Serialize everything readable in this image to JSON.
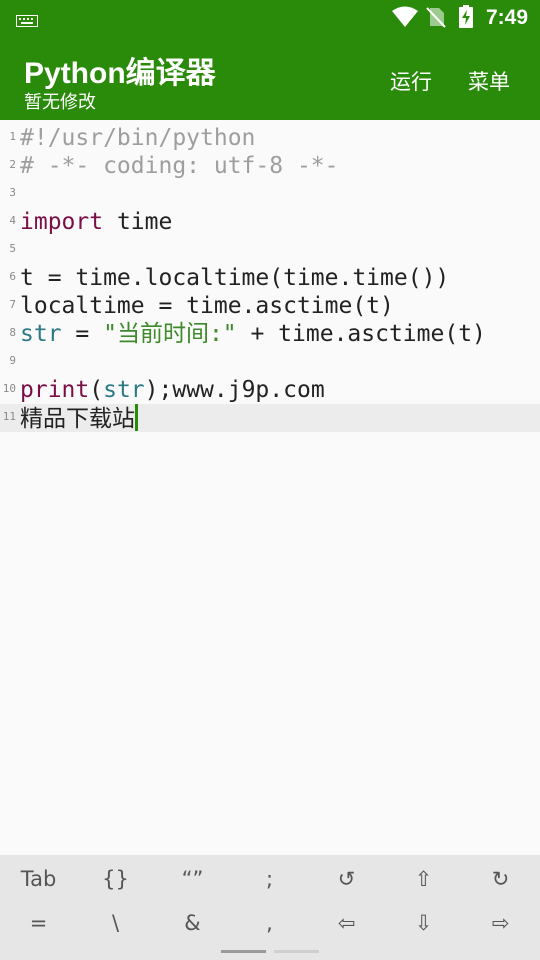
{
  "status_bar": {
    "time": "7:49",
    "icons": [
      "keyboard-icon",
      "wifi-icon",
      "no-sim-icon",
      "battery-charging-icon"
    ]
  },
  "app_bar": {
    "title": "Python编译器",
    "subtitle": "暂无修改",
    "actions": {
      "run": "运行",
      "menu": "菜单"
    }
  },
  "editor": {
    "line_numbers": [
      "1",
      "2",
      "3",
      "4",
      "5",
      "6",
      "7",
      "8",
      "9",
      "10",
      "11"
    ],
    "l1": "#!/usr/bin/python",
    "l2": "# -*- coding: utf-8 -*-",
    "l4_kw": "import",
    "l4_rest": " time",
    "l6": "t = time.localtime(time.time())",
    "l7": "localtime = time.asctime(t)",
    "l8_var": "str",
    "l8_eq": " = ",
    "l8_str": "\"当前时间:\"",
    "l8_rest": " + time.asctime(t)",
    "l10_kw": "print",
    "l10_p1": "(",
    "l10_var": "str",
    "l10_rest": ");www.j9p.com",
    "l11": "精品下载站"
  },
  "keybar": {
    "row1": [
      "Tab",
      "{}",
      "“”",
      ";",
      "↺",
      "⇧",
      "↻"
    ],
    "row2": [
      "=",
      "\\",
      "&",
      ",",
      "⇦",
      "⇩",
      "⇨"
    ]
  },
  "colors": {
    "primary": "#2a8a0a",
    "keyword": "#7a0f48",
    "builtin": "#2b7a85",
    "string": "#3e8a2a",
    "comment": "#9e9e9e"
  }
}
